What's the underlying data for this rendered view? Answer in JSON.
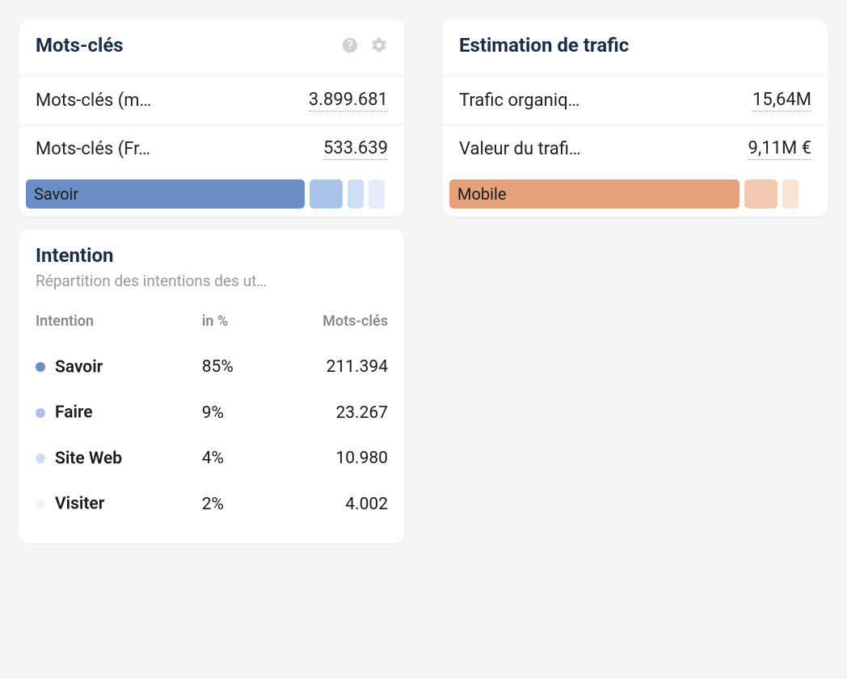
{
  "keywords": {
    "title": "Mots-clés",
    "rows": [
      {
        "label": "Mots-clés (m…",
        "value": "3.899.681"
      },
      {
        "label": "Mots-clés (Fr…",
        "value": "533.639"
      }
    ],
    "bar": {
      "label": "Savoir",
      "segments": [
        {
          "width": 75,
          "color": "#6a8fc7"
        },
        {
          "width": 9,
          "color": "#a9c3e6"
        },
        {
          "width": 4,
          "color": "#cdddf3"
        },
        {
          "width": 3,
          "color": "#e4ecf9"
        }
      ]
    }
  },
  "traffic": {
    "title": "Estimation de trafic",
    "rows": [
      {
        "label": "Trafic organiq…",
        "value": "15,64M"
      },
      {
        "label": "Valeur du trafi…",
        "value": "9,11M €"
      }
    ],
    "bar": {
      "label": "Mobile",
      "segments": [
        {
          "width": 78,
          "color": "#e5a178"
        },
        {
          "width": 9,
          "color": "#f2c9af"
        },
        {
          "width": 3,
          "color": "#f9e3d5"
        }
      ]
    }
  },
  "intention": {
    "title": "Intention",
    "subtitle": "Répartition des intentions des ut…",
    "headers": {
      "col1": "Intention",
      "col2": "in %",
      "col3": "Mots-clés"
    },
    "rows": [
      {
        "name": "Savoir",
        "pct": "85%",
        "count": "211.394",
        "dot": "#6a8fc7"
      },
      {
        "name": "Faire",
        "pct": "9%",
        "count": "23.267",
        "dot": "#a9c3e6"
      },
      {
        "name": "Site Web",
        "pct": "4%",
        "count": "10.980",
        "dot": "#cdddf3"
      },
      {
        "name": "Visiter",
        "pct": "2%",
        "count": "4.002",
        "dot": "#eef3fb"
      }
    ]
  }
}
